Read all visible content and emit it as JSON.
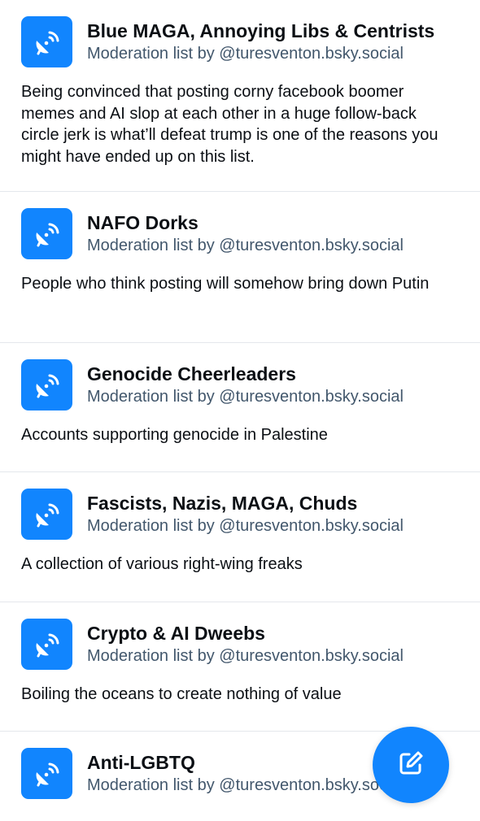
{
  "lists": [
    {
      "title": "Blue MAGA, Annoying Libs & Centrists",
      "subtitle": "Moderation list by @turesventon.bsky.social",
      "description": "Being convinced that posting corny facebook boomer memes and AI slop at each other in a huge follow-back circle jerk is what’ll defeat trump is one of the reasons you might have ended up on this list."
    },
    {
      "title": "NAFO Dorks",
      "subtitle": "Moderation list by @turesventon.bsky.social",
      "description": "People who think posting will somehow bring down Putin"
    },
    {
      "title": "Genocide Cheerleaders",
      "subtitle": "Moderation list by @turesventon.bsky.social",
      "description": "Accounts supporting genocide in Palestine"
    },
    {
      "title": "Fascists, Nazis, MAGA, Chuds",
      "subtitle": "Moderation list by @turesventon.bsky.social",
      "description": "A collection of various right-wing freaks"
    },
    {
      "title": "Crypto & AI Dweebs",
      "subtitle": "Moderation list by @turesventon.bsky.social",
      "description": "Boiling the oceans to create nothing of value"
    },
    {
      "title": "Anti-LGBTQ",
      "subtitle": "Moderation list by @turesventon.bsky.social",
      "description": ""
    }
  ],
  "icons": {
    "list_avatar": "satellite-dish-icon",
    "compose": "compose-icon"
  },
  "colors": {
    "accent": "#1185fe",
    "subtitle": "#42576c",
    "text": "#0b0f14",
    "divider": "#e4e7ec"
  }
}
